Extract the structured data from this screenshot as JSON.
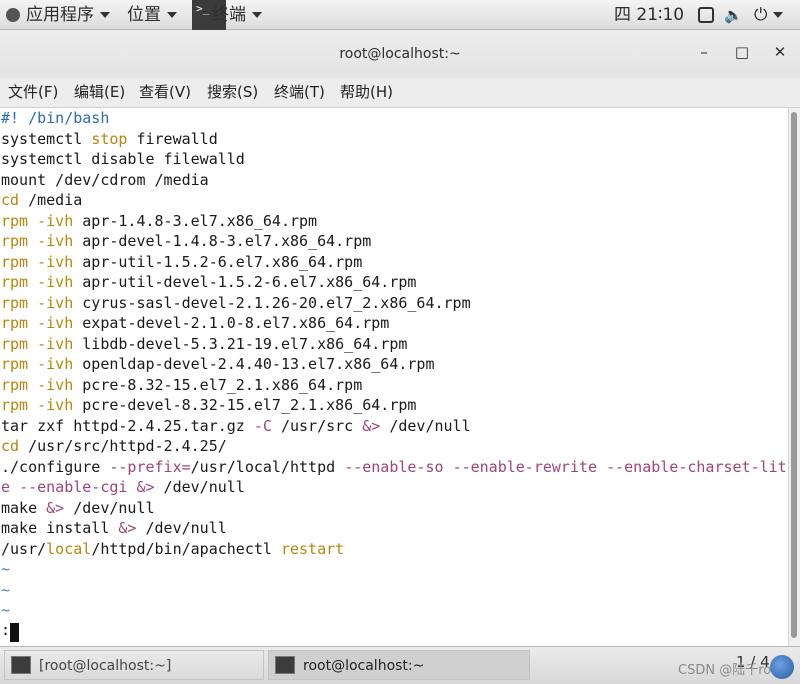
{
  "top_panel": {
    "apps": "应用程序",
    "places": "位置",
    "terminal": "终端",
    "clock": "四 21∶10"
  },
  "window": {
    "title": "root@localhost:~",
    "minimize": "–",
    "maximize": "□",
    "close": "✕"
  },
  "menubar": [
    "文件(F)",
    "编辑(E)",
    "查看(V)",
    "搜索(S)",
    "终端(T)",
    "帮助(H)"
  ],
  "terminal_lines": [
    "#! /bin/bash",
    "systemctl stop firewalld",
    "systemctl disable filewalld",
    "mount /dev/cdrom /media",
    "cd /media",
    "rpm -ivh apr-1.4.8-3.el7.x86_64.rpm",
    "rpm -ivh apr-devel-1.4.8-3.el7.x86_64.rpm",
    "rpm -ivh apr-util-1.5.2-6.el7.x86_64.rpm",
    "rpm -ivh apr-util-devel-1.5.2-6.el7.x86_64.rpm",
    "rpm -ivh cyrus-sasl-devel-2.1.26-20.el7_2.x86_64.rpm",
    "rpm -ivh expat-devel-2.1.0-8.el7.x86_64.rpm",
    "rpm -ivh libdb-devel-5.3.21-19.el7.x86_64.rpm",
    "rpm -ivh openldap-devel-2.4.40-13.el7.x86_64.rpm",
    "rpm -ivh pcre-8.32-15.el7_2.1.x86_64.rpm",
    "rpm -ivh pcre-devel-8.32-15.el7_2.1.x86_64.rpm",
    "tar zxf httpd-2.4.25.tar.gz -C /usr/src &> /dev/null",
    "cd /usr/src/httpd-2.4.25/",
    "./configure --prefix=/usr/local/httpd --enable-so --enable-rewrite --enable-charset-lit",
    "e --enable-cgi &> /dev/null",
    "make &> /dev/null",
    "make install &> /dev/null",
    "/usr/local/httpd/bin/apachectl restart",
    "~",
    "~",
    "~"
  ],
  "command_line": ":",
  "taskbar": {
    "task1": "[root@localhost:~]",
    "task2": "root@localhost:~",
    "pager": "1 / 4",
    "watermark": "CSDN @陆千roc"
  }
}
